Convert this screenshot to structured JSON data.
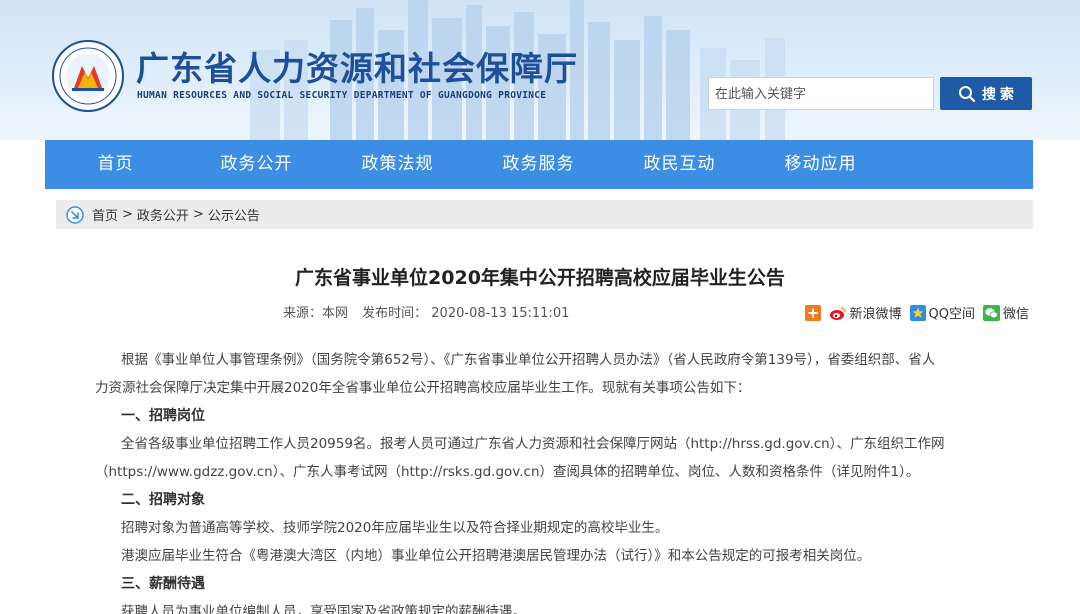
{
  "header": {
    "site_title": "广东省人力资源和社会保障厅",
    "site_subtitle": "HUMAN RESOURCES AND SOCIAL SECURITY DEPARTMENT OF GUANGDONG PROVINCE",
    "search_placeholder": "在此输入关键字",
    "search_button": "搜 索"
  },
  "nav": {
    "items": [
      "首页",
      "政务公开",
      "政策法规",
      "政务服务",
      "政民互动",
      "移动应用"
    ]
  },
  "breadcrumb": {
    "items": [
      "首页",
      "政务公开",
      "公示公告"
    ],
    "separator": ">"
  },
  "article": {
    "title": "广东省事业单位2020年集中公开招聘高校应届毕业生公告",
    "source": "来源：本网",
    "published": "发布时间：  2020-08-13 15:11:01",
    "share": {
      "weibo": "新浪微博",
      "qzone": "QQ空间",
      "wechat": "微信"
    },
    "lines": [
      "根据《事业单位人事管理条例》（国务院令第652号）、《广东省事业单位公开招聘人员办法》（省人民政府令第139号），省委组织部、省人",
      "力资源社会保障厅决定集中开展2020年全省事业单位公开招聘高校应届毕业生工作。现就有关事项公告如下：",
      "一、招聘岗位",
      "全省各级事业单位招聘工作人员20959名。报考人员可通过广东省人力资源和社会保障厅网站（http://hrss.gd.gov.cn）、广东组织工作网",
      "（https://www.gdzz.gov.cn）、广东人事考试网（http://rsks.gd.gov.cn）查阅具体的招聘单位、岗位、人数和资格条件（详见附件1）。",
      "二、招聘对象",
      "招聘对象为普通高等学校、技师学院2020年应届毕业生以及符合择业期规定的高校毕业生。",
      "港澳应届毕业生符合《粤港澳大湾区（内地）事业单位公开招聘港澳居民管理办法（试行）》和本公告规定的可报考相关岗位。",
      "三、薪酬待遇",
      "获聘人员为事业单位编制人员，享受国家及省政策规定的薪酬待遇。"
    ]
  },
  "colors": {
    "nav_bg": "#3b8ee3",
    "search_btn": "#1f5aa6",
    "title_blue": "#1d4f9a"
  }
}
